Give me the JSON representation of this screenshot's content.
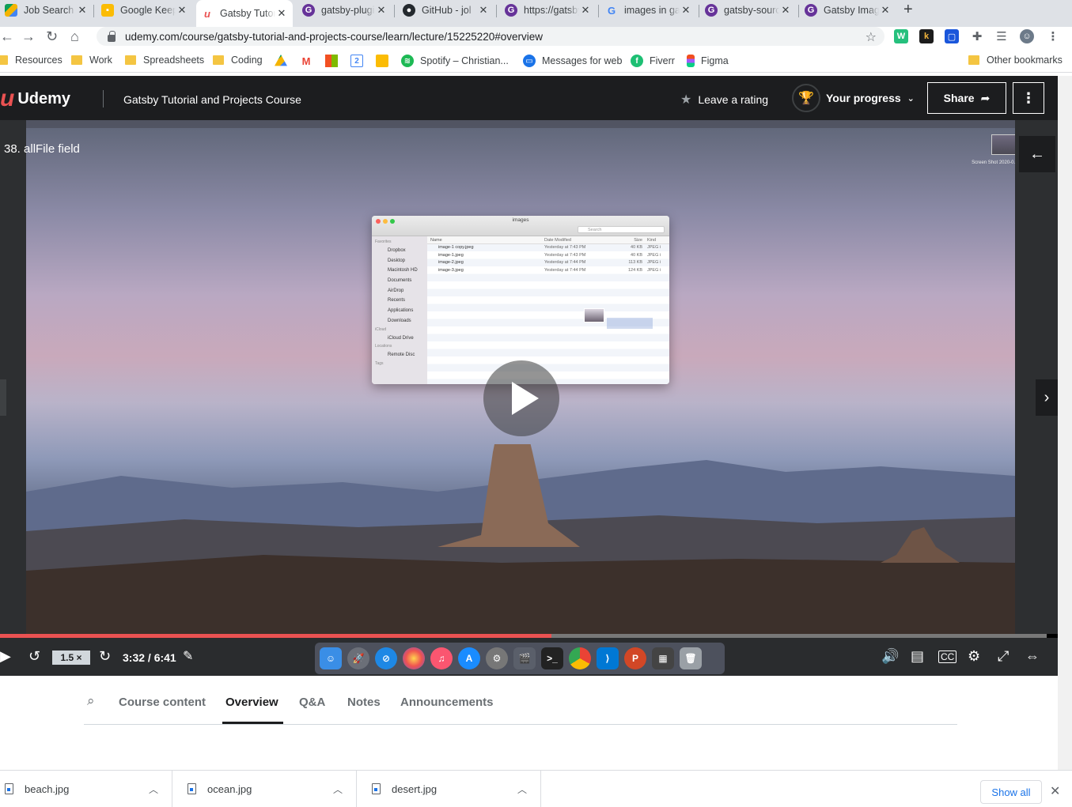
{
  "browser": {
    "tabs": [
      {
        "title": "Job Search",
        "icon": "google-drive-icon"
      },
      {
        "title": "Google Keep",
        "icon": "google-keep-icon"
      },
      {
        "title": "Gatsby Tutorial",
        "icon": "udemy-icon"
      },
      {
        "title": "gatsby-plugin",
        "icon": "gatsby-icon"
      },
      {
        "title": "GitHub - jol",
        "icon": "github-icon"
      },
      {
        "title": "https://gatsby",
        "icon": "gatsby-icon"
      },
      {
        "title": "images in gatsby",
        "icon": "google-icon"
      },
      {
        "title": "gatsby-source",
        "icon": "gatsby-icon"
      },
      {
        "title": "Gatsby Images",
        "icon": "gatsby-icon"
      }
    ],
    "active_tab_index": 2,
    "url": "udemy.com/course/gatsby-tutorial-and-projects-course/learn/lecture/15225220#overview",
    "bookmarks": [
      {
        "label": "Resources",
        "type": "folder"
      },
      {
        "label": "Work",
        "type": "folder"
      },
      {
        "label": "Spreadsheets",
        "type": "folder"
      },
      {
        "label": "Coding",
        "type": "folder"
      },
      {
        "label": "",
        "type": "drive"
      },
      {
        "label": "",
        "type": "gmail"
      },
      {
        "label": "",
        "type": "office"
      },
      {
        "label": "",
        "type": "calendar"
      },
      {
        "label": "",
        "type": "keep"
      },
      {
        "label": "Spotify – Christian...",
        "type": "spotify"
      },
      {
        "label": "Messages for web",
        "type": "messages"
      },
      {
        "label": "Fiverr",
        "type": "fiverr"
      },
      {
        "label": "Figma",
        "type": "figma"
      }
    ],
    "other_bookmarks": "Other bookmarks"
  },
  "header": {
    "logo_text": "Udemy",
    "course_title": "Gatsby Tutorial and Projects Course",
    "rating_label": "Leave a rating",
    "progress_label": "Your progress",
    "share_label": "Share"
  },
  "player": {
    "lecture_title": "38. allFile field",
    "speed": "1.5 ×",
    "time": "3:32 / 6:41",
    "progress": 0.527,
    "screenshot_caption": "Screen Shot 2020-0...19.24 AM",
    "finder": {
      "title": "images",
      "search_placeholder": "Search",
      "sidebar_favorites_header": "Favorites",
      "sidebar_favorites": [
        "Dropbox",
        "Desktop",
        "Macintosh HD",
        "Documents",
        "AirDrop",
        "Recents",
        "Applications",
        "Downloads"
      ],
      "sidebar_icloud_header": "iCloud",
      "sidebar_icloud": [
        "iCloud Drive"
      ],
      "sidebar_locations_header": "Locations",
      "sidebar_locations": [
        "Remote Disc"
      ],
      "sidebar_tags_header": "Tags",
      "columns": [
        "Name",
        "Date Modified",
        "Size",
        "Kind"
      ],
      "files": [
        {
          "name": "image-1 copy.jpeg",
          "date": "Yesterday at 7:43 PM",
          "size": "40 KB",
          "kind": "JPEG i"
        },
        {
          "name": "image-1.jpeg",
          "date": "Yesterday at 7:43 PM",
          "size": "40 KB",
          "kind": "JPEG i"
        },
        {
          "name": "image-2.jpeg",
          "date": "Yesterday at 7:44 PM",
          "size": "113 KB",
          "kind": "JPEG i"
        },
        {
          "name": "image-3.jpeg",
          "date": "Yesterday at 7:44 PM",
          "size": "124 KB",
          "kind": "JPEG i"
        }
      ]
    }
  },
  "content_tabs": {
    "course_content": "Course content",
    "overview": "Overview",
    "qa": "Q&A",
    "notes": "Notes",
    "announcements": "Announcements"
  },
  "downloads": {
    "files": [
      "beach.jpg",
      "ocean.jpg",
      "desert.jpg"
    ],
    "show_all": "Show all"
  },
  "colors": {
    "udemy_header": "#1c1d1f",
    "udemy_accent": "#ea5252",
    "chrome_link": "#1a73e8"
  }
}
